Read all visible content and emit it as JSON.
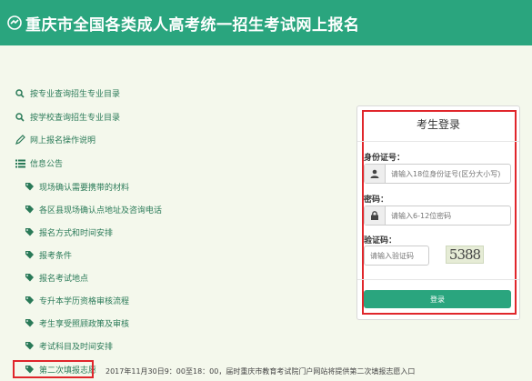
{
  "header": {
    "title": "重庆市全国各类成人高考统一招生考试网上报名"
  },
  "nav": {
    "search_major": "按专业查询招生专业目录",
    "search_school": "按学校查询招生专业目录",
    "guide": "网上报名操作说明",
    "announcements": "信息公告",
    "sub_items": [
      "现场确认需要携带的材料",
      "各区县现场确认点地址及咨询电话",
      "报名方式和时间安排",
      "报考条件",
      "报名考试地点",
      "专升本学历资格审核流程",
      "考生享受照顾政策及审核",
      "考试科目及时间安排",
      "第二次填报志愿"
    ]
  },
  "notice": "2017年11月30日9：00至18：00，届时重庆市教育考试院门户网站将提供第二次填报志愿入口",
  "login": {
    "title": "考生登录",
    "id_label": "身份证号：",
    "id_placeholder": "请输入18位身份证号(区分大小写)",
    "password_label": "密码：",
    "password_placeholder": "请输入6-12位密码",
    "captcha_label": "验证码：",
    "captcha_placeholder": "请输入验证码",
    "captcha_text": "5388",
    "login_button": "登录"
  },
  "colors": {
    "brand": "#2aa57e",
    "highlight": "#e0262b",
    "background": "#f4f8ec"
  },
  "icons": {
    "search": "search-icon",
    "guide": "pencil-icon",
    "list": "list-icon",
    "tag": "tag-icon",
    "user": "user-icon",
    "lock": "lock-icon"
  }
}
